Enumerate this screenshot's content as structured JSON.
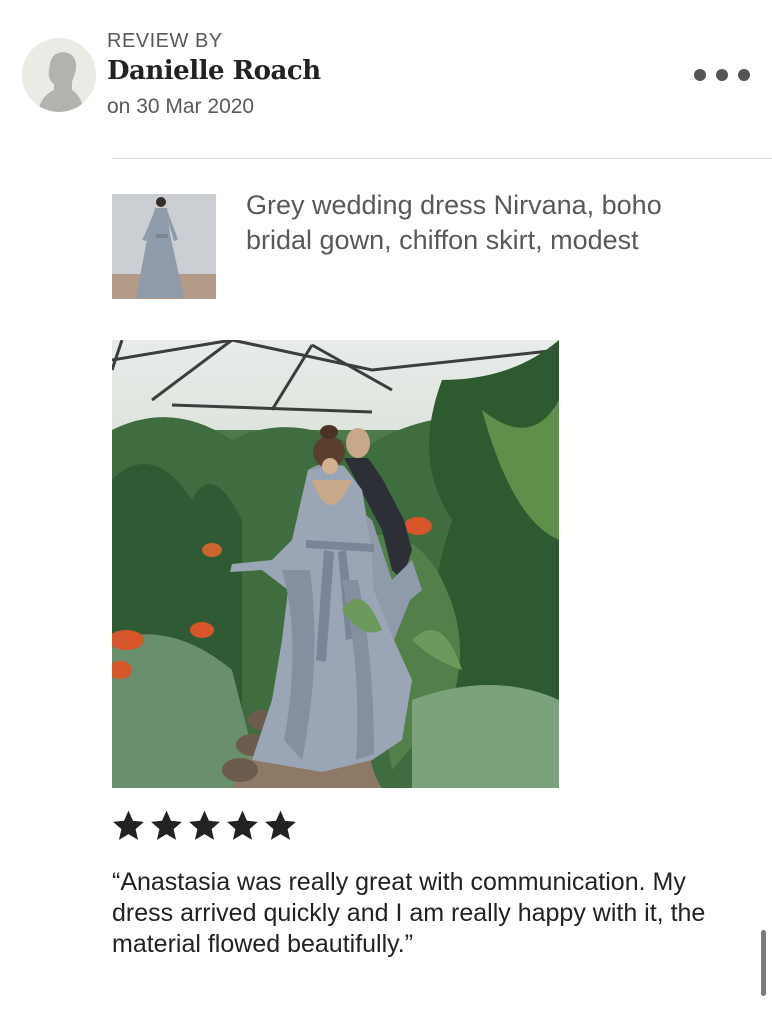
{
  "review": {
    "header_label": "REVIEW BY",
    "reviewer_name": "Danielle Roach",
    "date": "on 30 Mar 2020",
    "rating": 5,
    "rating_max": 5,
    "text": "“Anastasia was really great with communication. My dress arrived quickly and I am really happy with it, the material flowed beautifully.”"
  },
  "listing": {
    "title": "Grey wedding dress Nirvana, boho bridal gown, chiffon skirt, modest"
  },
  "icons": {
    "avatar": "person-silhouette-icon",
    "more": "more-options-icon",
    "star": "star-icon"
  },
  "colors": {
    "star": "#222222",
    "muted_text": "#595959",
    "dress": "#8f9bab",
    "foliage": "#3d6b3f",
    "flower": "#d6552a"
  }
}
